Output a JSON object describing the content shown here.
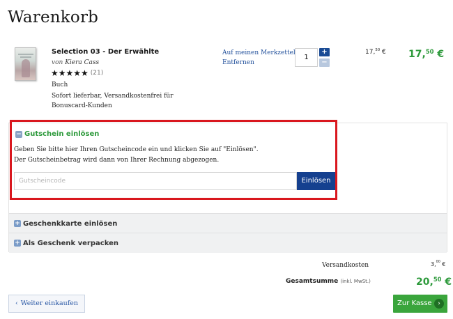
{
  "page": {
    "title": "Warenkorb"
  },
  "product": {
    "title": "Selection 03 - Der Erwählte",
    "author_prefix": "von",
    "author": "Kiera Cass",
    "stars": "★★★★★",
    "rating_count": "(21)",
    "type": "Buch",
    "availability": "Sofort lieferbar, Versandkostenfrei für Bonuscard-Kunden",
    "link_wishlist": "Auf meinen Merkzettel",
    "link_remove": "Entfernen",
    "quantity": "1",
    "qty_plus": "+",
    "qty_minus": "−",
    "unit_price_main": "17,",
    "unit_price_cents": "50",
    "unit_price_currency": " €",
    "total_price_main": "17,",
    "total_price_cents": "50",
    "total_price_currency": " €"
  },
  "voucher": {
    "toggle": "−",
    "title": "Gutschein einlösen",
    "text_line1": "Geben Sie bitte hier Ihren Gutscheincode ein und klicken Sie auf \"Einlösen\".",
    "text_line2": "Der Gutscheinbetrag wird dann von Ihrer Rechnung abgezogen.",
    "placeholder": "Gutscheincode",
    "value": "",
    "button": "Einlösen"
  },
  "giftcard": {
    "toggle": "+",
    "label": "Geschenkkarte einlösen"
  },
  "giftwrap": {
    "toggle": "+",
    "label": "Als Geschenk verpacken"
  },
  "totals": {
    "shipping_label": "Versandkosten",
    "shipping_main": "3,",
    "shipping_cents": "00",
    "shipping_currency": " €",
    "grand_label": "Gesamtsumme",
    "grand_incl": "(inkl. MwSt.)",
    "grand_main": "20,",
    "grand_cents": "50",
    "grand_currency": " €"
  },
  "actions": {
    "continue_chevron": "‹",
    "continue_label": "Weiter einkaufen",
    "checkout_label": "Zur Kasse",
    "checkout_arrow": "›"
  },
  "colors": {
    "price_green": "#2e9a3c",
    "link_blue": "#1f4e9a",
    "button_blue": "#15408f",
    "highlight_red": "#d9171e",
    "checkout_green": "#3aa53c"
  }
}
